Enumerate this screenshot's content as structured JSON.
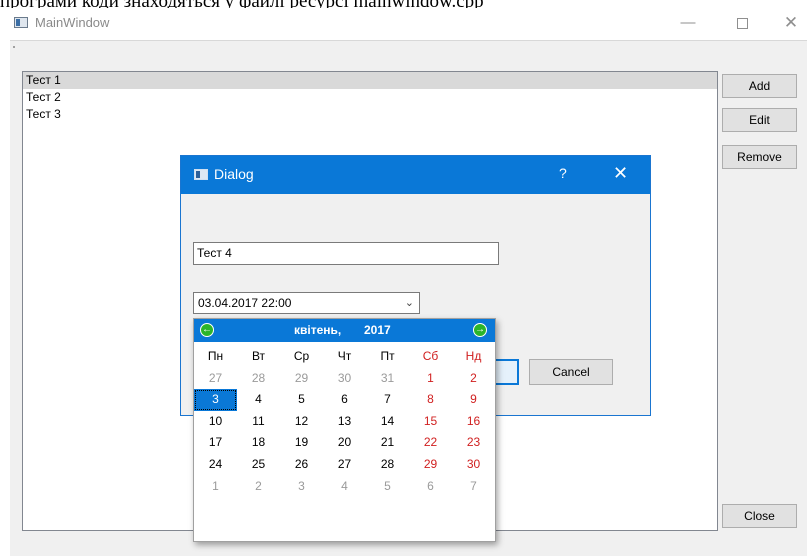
{
  "caption_fragment": "програми коди знаходяться у файлі ресурсі mainwindow.cpp",
  "window": {
    "title": "MainWindow",
    "min_glyph": "—",
    "close_glyph": "✕"
  },
  "list": {
    "items": [
      "Тест 1",
      "Тест 2",
      "Тест 3"
    ],
    "selected_index": 0
  },
  "buttons": {
    "add": "Add",
    "edit": "Edit",
    "remove": "Remove",
    "close": "Close"
  },
  "dialog": {
    "title": "Dialog",
    "help_glyph": "?",
    "close_glyph": "✕",
    "text_value": "Тест 4",
    "datetime_value": "03.04.2017 22:00",
    "dropdown_glyph": "⌄",
    "cancel_label": "Cancel"
  },
  "calendar": {
    "month": "квітень,",
    "year": "2017",
    "prev_glyph": "←",
    "next_glyph": "→",
    "weekdays": [
      "Пн",
      "Вт",
      "Ср",
      "Чт",
      "Пт",
      "Сб",
      "Нд"
    ],
    "weeks": [
      [
        "27",
        "28",
        "29",
        "30",
        "31",
        "1",
        "2"
      ],
      [
        "3",
        "4",
        "5",
        "6",
        "7",
        "8",
        "9"
      ],
      [
        "10",
        "11",
        "12",
        "13",
        "14",
        "15",
        "16"
      ],
      [
        "17",
        "18",
        "19",
        "20",
        "21",
        "22",
        "23"
      ],
      [
        "24",
        "25",
        "26",
        "27",
        "28",
        "29",
        "30"
      ],
      [
        "1",
        "2",
        "3",
        "4",
        "5",
        "6",
        "7"
      ]
    ],
    "selected_day": "3",
    "colors": {
      "accent": "#0a78d7",
      "weekend": "#d01f1f",
      "muted": "#9a9a9a",
      "nav": "#2bb52b"
    }
  }
}
